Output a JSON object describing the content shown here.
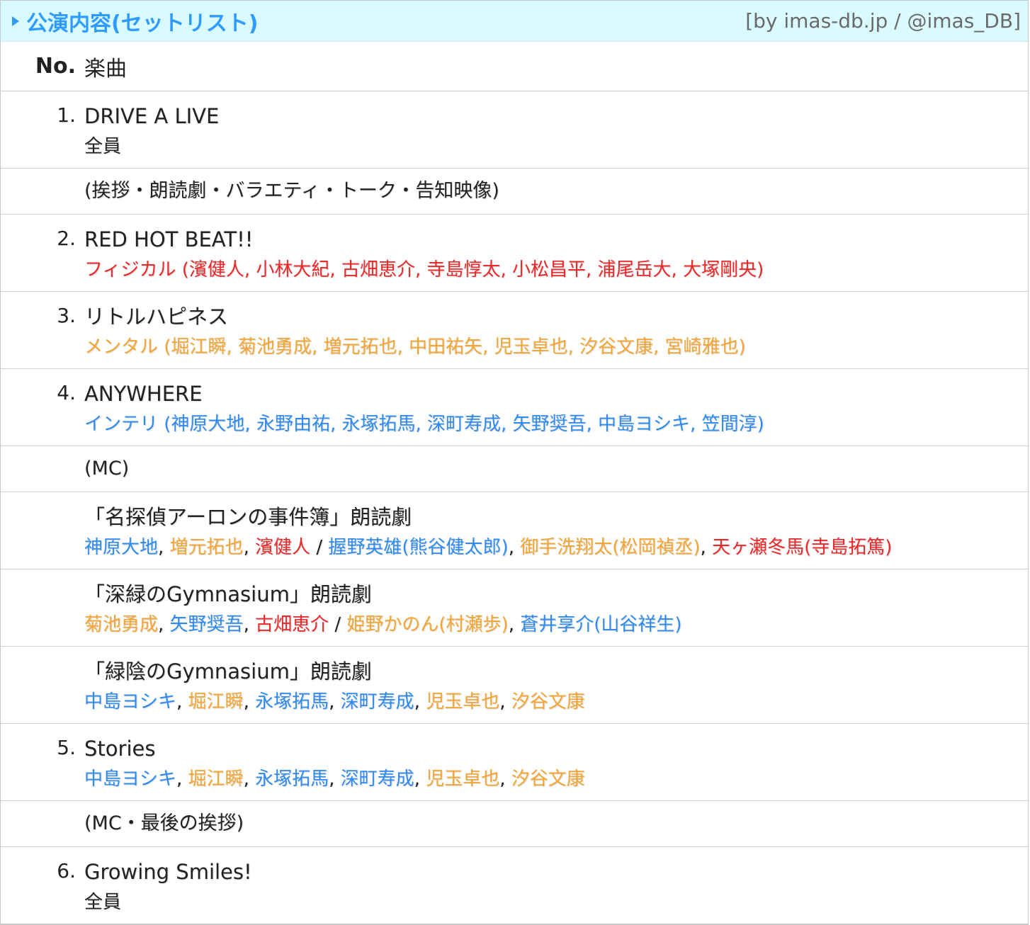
{
  "header": {
    "title": "公演内容(セットリスト)",
    "credit": "[by imas-db.jp / @imas_DB]"
  },
  "table": {
    "col_no": "No.",
    "col_song": "楽曲"
  },
  "colors": {
    "physical": "#ea2a2a",
    "mental": "#f4a533",
    "intelli": "#2f8bef",
    "accent": "#2f9bff",
    "header_bg": "#d9fbff"
  },
  "rows": [
    {
      "type": "song",
      "num": "1.",
      "title": "DRIVE A LIVE",
      "cast": [
        {
          "text": "全員",
          "c": "plain"
        }
      ]
    },
    {
      "type": "note",
      "text": "(挨拶・朗読劇・バラエティ・トーク・告知映像)"
    },
    {
      "type": "song",
      "num": "2.",
      "title": "RED HOT BEAT!!",
      "cast": [
        {
          "text": "フィジカル (濱健人, 小林大紀, 古畑恵介, 寺島惇太, 小松昌平, 浦尾岳大, 大塚剛央)",
          "c": "physical"
        }
      ]
    },
    {
      "type": "song",
      "num": "3.",
      "title": "リトルハピネス",
      "cast": [
        {
          "text": "メンタル (堀江瞬, 菊池勇成, 増元拓也, 中田祐矢, 児玉卓也, 汐谷文康, 宮崎雅也)",
          "c": "mental"
        }
      ]
    },
    {
      "type": "song",
      "num": "4.",
      "title": "ANYWHERE",
      "cast": [
        {
          "text": "インテリ (神原大地, 永野由祐, 永塚拓馬, 深町寿成, 矢野奨吾, 中島ヨシキ, 笠間淳)",
          "c": "intelli"
        }
      ]
    },
    {
      "type": "note",
      "text": "(MC)"
    },
    {
      "type": "song",
      "num": "",
      "title": "「名探偵アーロンの事件簿」朗読劇",
      "cast": [
        {
          "text": "神原大地",
          "c": "intelli"
        },
        {
          "text": ", ",
          "c": "plain"
        },
        {
          "text": "増元拓也",
          "c": "mental"
        },
        {
          "text": ", ",
          "c": "plain"
        },
        {
          "text": "濱健人",
          "c": "physical"
        },
        {
          "text": " / ",
          "c": "plain"
        },
        {
          "text": "握野英雄(熊谷健太郎)",
          "c": "intelli"
        },
        {
          "text": ", ",
          "c": "plain"
        },
        {
          "text": "御手洗翔太(松岡禎丞)",
          "c": "mental"
        },
        {
          "text": ", ",
          "c": "plain"
        },
        {
          "text": "天ヶ瀬冬馬(寺島拓篤)",
          "c": "physical"
        }
      ]
    },
    {
      "type": "song",
      "num": "",
      "title": "「深緑のGymnasium」朗読劇",
      "cast": [
        {
          "text": "菊池勇成",
          "c": "mental"
        },
        {
          "text": ", ",
          "c": "plain"
        },
        {
          "text": "矢野奨吾",
          "c": "intelli"
        },
        {
          "text": ", ",
          "c": "plain"
        },
        {
          "text": "古畑恵介",
          "c": "physical"
        },
        {
          "text": " / ",
          "c": "plain"
        },
        {
          "text": "姫野かのん(村瀬歩)",
          "c": "mental"
        },
        {
          "text": ", ",
          "c": "plain"
        },
        {
          "text": "蒼井享介(山谷祥生)",
          "c": "intelli"
        }
      ]
    },
    {
      "type": "song",
      "num": "",
      "title": "「緑陰のGymnasium」朗読劇",
      "cast": [
        {
          "text": "中島ヨシキ",
          "c": "intelli"
        },
        {
          "text": ", ",
          "c": "plain"
        },
        {
          "text": "堀江瞬",
          "c": "mental"
        },
        {
          "text": ", ",
          "c": "plain"
        },
        {
          "text": "永塚拓馬",
          "c": "intelli"
        },
        {
          "text": ", ",
          "c": "plain"
        },
        {
          "text": "深町寿成",
          "c": "intelli"
        },
        {
          "text": ", ",
          "c": "plain"
        },
        {
          "text": "児玉卓也",
          "c": "mental"
        },
        {
          "text": ", ",
          "c": "plain"
        },
        {
          "text": "汐谷文康",
          "c": "mental"
        }
      ]
    },
    {
      "type": "song",
      "num": "5.",
      "title": "Stories",
      "cast": [
        {
          "text": "中島ヨシキ",
          "c": "intelli"
        },
        {
          "text": ", ",
          "c": "plain"
        },
        {
          "text": "堀江瞬",
          "c": "mental"
        },
        {
          "text": ", ",
          "c": "plain"
        },
        {
          "text": "永塚拓馬",
          "c": "intelli"
        },
        {
          "text": ", ",
          "c": "plain"
        },
        {
          "text": "深町寿成",
          "c": "intelli"
        },
        {
          "text": ", ",
          "c": "plain"
        },
        {
          "text": "児玉卓也",
          "c": "mental"
        },
        {
          "text": ", ",
          "c": "plain"
        },
        {
          "text": "汐谷文康",
          "c": "mental"
        }
      ]
    },
    {
      "type": "note",
      "text": "(MC・最後の挨拶)"
    },
    {
      "type": "song",
      "num": "6.",
      "title": "Growing Smiles!",
      "cast": [
        {
          "text": "全員",
          "c": "plain"
        }
      ]
    }
  ]
}
